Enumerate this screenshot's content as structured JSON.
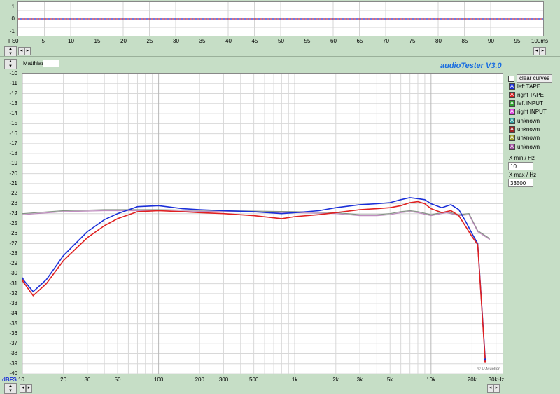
{
  "top_chart": {
    "y_labels": [
      "1",
      "0",
      "-1"
    ],
    "x_prefix": "FS",
    "x_labels": [
      "0",
      "5",
      "10",
      "15",
      "20",
      "25",
      "30",
      "35",
      "40",
      "45",
      "50",
      "55",
      "60",
      "65",
      "70",
      "75",
      "80",
      "85",
      "90",
      "95",
      "100ms"
    ]
  },
  "main": {
    "name_label": "Matthias I",
    "title": "audioTester  V3.0",
    "copyright": "© U.Mueller",
    "y_unit": "dBFS",
    "y_labels": [
      "-10",
      "-11",
      "-12",
      "-13",
      "-14",
      "-15",
      "-16",
      "-17",
      "-18",
      "-19",
      "-20",
      "-21",
      "-22",
      "-23",
      "-24",
      "-25",
      "-26",
      "-27",
      "-28",
      "-29",
      "-30",
      "-31",
      "-32",
      "-33",
      "-34",
      "-35",
      "-36",
      "-37",
      "-38",
      "-39",
      "-40"
    ],
    "x_labels": [
      "10",
      "20",
      "30",
      "50",
      "100",
      "200",
      "300",
      "500",
      "1k",
      "2k",
      "3k",
      "5k",
      "10k",
      "20k",
      "30kHz"
    ]
  },
  "controls": {
    "clear_curves": "clear curves",
    "legend": [
      {
        "label": "left TAPE",
        "color": "#1a2fd8"
      },
      {
        "label": "right TAPE",
        "color": "#e02020"
      },
      {
        "label": "left INPUT",
        "color": "#30a030"
      },
      {
        "label": "right INPUT",
        "color": "#e040e0"
      },
      {
        "label": "unknown",
        "color": "#30a0a0"
      },
      {
        "label": "unknown",
        "color": "#a02020"
      },
      {
        "label": "unknown",
        "color": "#a0a030"
      },
      {
        "label": "unknown",
        "color": "#a050a0"
      }
    ],
    "xmin_label": "X min / Hz",
    "xmin_value": "10",
    "xmax_label": "X max / Hz",
    "xmax_value": "33500"
  },
  "chart_data": {
    "type": "line",
    "xscale": "log",
    "xlim": [
      10,
      33500
    ],
    "ylim": [
      -40,
      -10
    ],
    "xlabel": "",
    "ylabel": "dBFS",
    "series": [
      {
        "name": "left TAPE",
        "color": "#1a2fd8",
        "points": [
          [
            10,
            -30.5
          ],
          [
            12,
            -31.8
          ],
          [
            15,
            -30.6
          ],
          [
            20,
            -28.2
          ],
          [
            30,
            -25.8
          ],
          [
            40,
            -24.6
          ],
          [
            50,
            -24.0
          ],
          [
            70,
            -23.3
          ],
          [
            100,
            -23.2
          ],
          [
            150,
            -23.5
          ],
          [
            200,
            -23.6
          ],
          [
            300,
            -23.7
          ],
          [
            500,
            -23.8
          ],
          [
            800,
            -24.0
          ],
          [
            1000,
            -23.9
          ],
          [
            1500,
            -23.7
          ],
          [
            2000,
            -23.4
          ],
          [
            3000,
            -23.1
          ],
          [
            4000,
            -23.0
          ],
          [
            5000,
            -22.9
          ],
          [
            6000,
            -22.6
          ],
          [
            7000,
            -22.4
          ],
          [
            8000,
            -22.5
          ],
          [
            9000,
            -22.6
          ],
          [
            10000,
            -23.0
          ],
          [
            12000,
            -23.4
          ],
          [
            14000,
            -23.1
          ],
          [
            16000,
            -23.6
          ],
          [
            18000,
            -24.8
          ],
          [
            20000,
            -26.0
          ],
          [
            22000,
            -27.0
          ],
          [
            25000,
            -38.6
          ]
        ]
      },
      {
        "name": "right TAPE",
        "color": "#e02020",
        "points": [
          [
            10,
            -30.7
          ],
          [
            12,
            -32.2
          ],
          [
            15,
            -31.0
          ],
          [
            20,
            -28.7
          ],
          [
            30,
            -26.4
          ],
          [
            40,
            -25.2
          ],
          [
            50,
            -24.5
          ],
          [
            70,
            -23.8
          ],
          [
            100,
            -23.7
          ],
          [
            150,
            -23.8
          ],
          [
            200,
            -23.9
          ],
          [
            300,
            -24.0
          ],
          [
            500,
            -24.2
          ],
          [
            800,
            -24.5
          ],
          [
            1000,
            -24.3
          ],
          [
            1500,
            -24.1
          ],
          [
            2000,
            -23.9
          ],
          [
            3000,
            -23.6
          ],
          [
            4000,
            -23.5
          ],
          [
            5000,
            -23.4
          ],
          [
            6000,
            -23.2
          ],
          [
            7000,
            -22.9
          ],
          [
            8000,
            -22.8
          ],
          [
            9000,
            -23.0
          ],
          [
            10000,
            -23.5
          ],
          [
            12000,
            -23.9
          ],
          [
            14000,
            -23.7
          ],
          [
            16000,
            -24.2
          ],
          [
            18000,
            -25.3
          ],
          [
            20000,
            -26.3
          ],
          [
            22000,
            -27.1
          ],
          [
            25000,
            -38.8
          ]
        ]
      },
      {
        "name": "left INPUT",
        "color": "#30a030",
        "points": [
          [
            10,
            -24.0
          ],
          [
            20,
            -23.7
          ],
          [
            40,
            -23.6
          ],
          [
            100,
            -23.6
          ],
          [
            300,
            -23.7
          ],
          [
            1000,
            -23.8
          ],
          [
            2000,
            -23.9
          ],
          [
            3000,
            -24.1
          ],
          [
            4000,
            -24.1
          ],
          [
            5000,
            -24.0
          ],
          [
            6000,
            -23.8
          ],
          [
            7000,
            -23.7
          ],
          [
            8000,
            -23.8
          ],
          [
            10000,
            -24.1
          ],
          [
            13000,
            -23.8
          ],
          [
            16000,
            -24.1
          ],
          [
            19000,
            -24.0
          ],
          [
            22000,
            -25.7
          ],
          [
            27000,
            -26.5
          ]
        ]
      },
      {
        "name": "right INPUT",
        "color": "#e040e0",
        "points": [
          [
            10,
            -24.1
          ],
          [
            20,
            -23.8
          ],
          [
            40,
            -23.7
          ],
          [
            100,
            -23.7
          ],
          [
            300,
            -23.8
          ],
          [
            1000,
            -23.9
          ],
          [
            2000,
            -24.0
          ],
          [
            3000,
            -24.2
          ],
          [
            4000,
            -24.2
          ],
          [
            5000,
            -24.1
          ],
          [
            6000,
            -23.9
          ],
          [
            7000,
            -23.8
          ],
          [
            8000,
            -23.9
          ],
          [
            10000,
            -24.2
          ],
          [
            13000,
            -23.9
          ],
          [
            16000,
            -24.2
          ],
          [
            19000,
            -24.1
          ],
          [
            22000,
            -25.8
          ],
          [
            27000,
            -26.6
          ]
        ]
      }
    ]
  }
}
